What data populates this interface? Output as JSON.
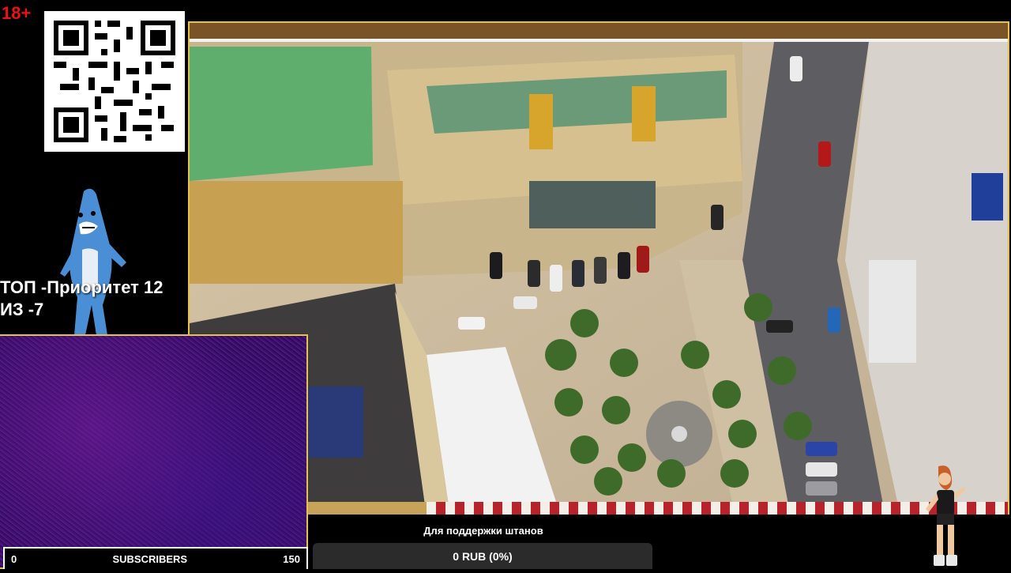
{
  "overlay": {
    "age_badge": "18+",
    "priority_line1": "ТОП -Приоритет 12",
    "priority_line2": "ИЗ -7"
  },
  "subscribers": {
    "start": "0",
    "label": "SUBSCRIBERS",
    "goal": "150"
  },
  "donation": {
    "title": "Для поддержки штанов",
    "amount": "0 RUB (0%)",
    "progress": 0
  },
  "colors": {
    "frame_border": "#e6c24a",
    "age_badge": "#ee1111",
    "noise_purple": "#2a0a55"
  },
  "icons": {
    "qr": "qr-code-icon",
    "shark": "dancing-shark-icon",
    "dancer": "dancing-character-icon"
  }
}
